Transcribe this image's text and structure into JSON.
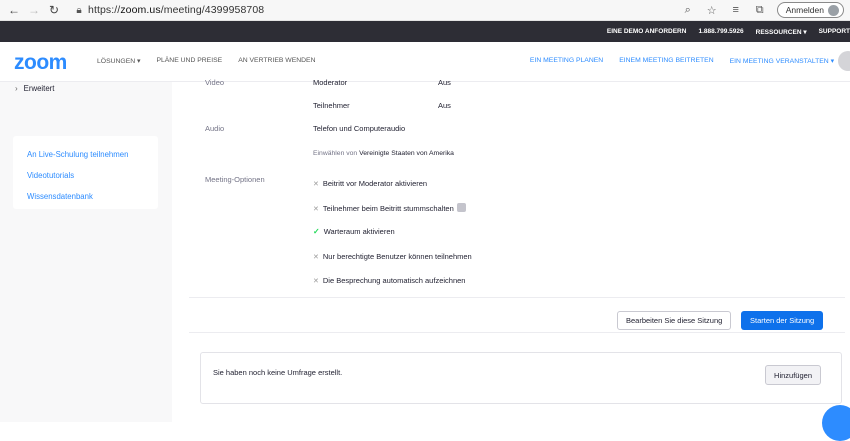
{
  "browser": {
    "url_prefix": "https://",
    "url_host": "zoom.us",
    "url_path": "/meeting/4399958708",
    "signin_label": "Anmelden"
  },
  "topbar": {
    "links": [
      "EINE DEMO ANFORDERN",
      "1.888.799.5926",
      "RESSOURCEN ▾",
      "SUPPORT"
    ]
  },
  "nav": {
    "logo": "zoom",
    "left": [
      "LÖSUNGEN ▾",
      "PLÄNE UND PREISE",
      "AN VERTRIEB WENDEN"
    ],
    "right": [
      "EIN MEETING PLANEN",
      "EINEM MEETING BEITRETEN",
      "EIN MEETING VERANSTALTEN ▾"
    ]
  },
  "sidebar": {
    "erweitert": "Erweitert",
    "links": [
      "An Live-Schulung teilnehmen",
      "Videotutorials",
      "Wissensdatenbank"
    ]
  },
  "details": {
    "video_label": "Video",
    "moderator_label": "Moderator",
    "moderator_value": "Aus",
    "teilnehmer_label": "Teilnehmer",
    "teilnehmer_value": "Aus",
    "audio_label": "Audio",
    "audio_value": "Telefon und Computeraudio",
    "dialin_prefix": "Einwählen von",
    "dialin_country": "Vereinigte Staaten von Amerika",
    "options_label": "Meeting-Optionen",
    "options": [
      {
        "text": "Beitritt vor Moderator aktivieren",
        "enabled": false
      },
      {
        "text": "Teilnehmer beim Beitritt stummschalten",
        "enabled": false
      },
      {
        "text": "Warteraum aktivieren",
        "enabled": true
      },
      {
        "text": "Nur berechtigte Benutzer können teilnehmen",
        "enabled": false
      },
      {
        "text": "Die Besprechung automatisch aufzeichnen",
        "enabled": false
      }
    ]
  },
  "actions": {
    "edit_label": "Bearbeiten Sie diese Sitzung",
    "start_label": "Starten der Sitzung"
  },
  "poll": {
    "empty_text": "Sie haben noch keine Umfrage erstellt.",
    "add_label": "Hinzufügen"
  },
  "colors": {
    "brand": "#2d8cff",
    "start_button": "#0e71eb",
    "topbar": "#2d2d35",
    "check": "#23d959"
  }
}
